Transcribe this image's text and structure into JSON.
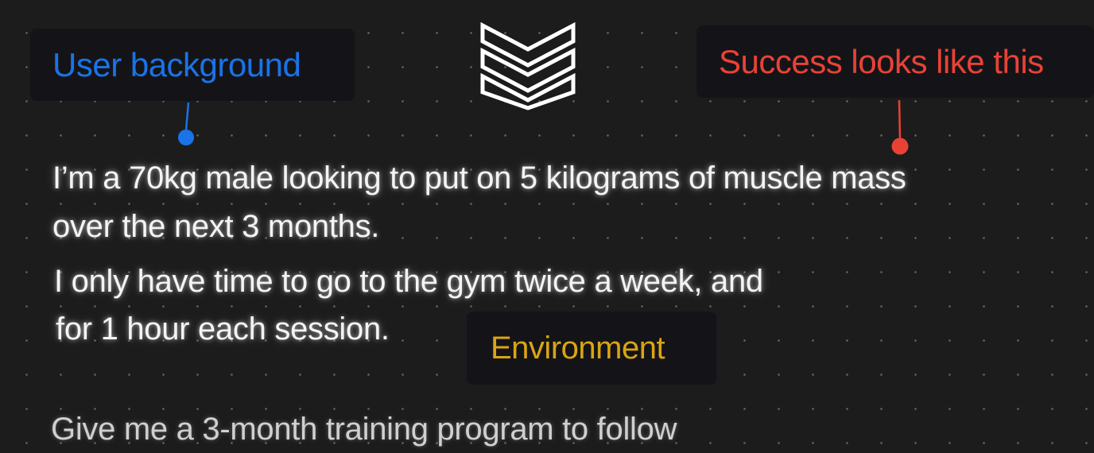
{
  "labels": {
    "user_background": {
      "text": "User background",
      "color": "#1a73e8"
    },
    "success": {
      "text": "Success looks like this",
      "color": "#e94235"
    },
    "environment": {
      "text": "Environment",
      "color": "#d9a514"
    }
  },
  "prompt": {
    "line1": "I’m a 70kg male looking to put on 5 kilograms of muscle mass",
    "line2": "over the next 3 months.",
    "line3": "I only have time to go to the gym twice a week, and",
    "line4": "for 1 hour each session.",
    "line5": "Give me a 3-month training program to follow"
  },
  "decor": {
    "center_icon": "triple-chevron-down-icon",
    "text_color": "#f4f4f4",
    "background": "#1c1c1d"
  }
}
